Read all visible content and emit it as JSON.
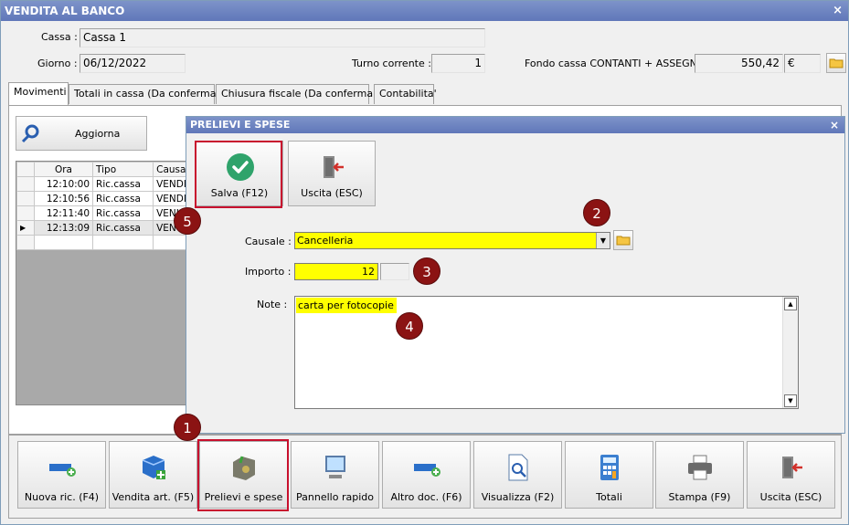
{
  "window": {
    "title": "VENDITA AL BANCO",
    "close": "×"
  },
  "header": {
    "cassa_label": "Cassa :",
    "cassa_value": "Cassa 1",
    "giorno_label": "Giorno :",
    "giorno_value": "06/12/2022",
    "turno_label": "Turno corrente :",
    "turno_value": "1",
    "fondo_label": "Fondo cassa CONTANTI + ASSEGNI :",
    "fondo_value": "550,42",
    "fondo_currency": "€"
  },
  "tabs": [
    "Movimenti",
    "Totali in cassa (Da confermare)",
    "Chiusura fiscale (Da confermare)",
    "Contabilita'"
  ],
  "aggiorna_label": "Aggiorna",
  "grid": {
    "columns": [
      "Ora",
      "Tipo",
      "Causa"
    ],
    "rows": [
      [
        "12:10:00",
        "Ric.cassa",
        "VENDI"
      ],
      [
        "12:10:56",
        "Ric.cassa",
        "VENDI"
      ],
      [
        "12:11:40",
        "Ric.cassa",
        "VENI"
      ],
      [
        "12:13:09",
        "Ric.cassa",
        "VEN"
      ]
    ],
    "current_row_marker": "▶"
  },
  "dialog": {
    "title": "PRELIEVI E SPESE",
    "close": "×",
    "salva_label": "Salva (F12)",
    "uscita_label": "Uscita (ESC)",
    "causale_label": "Causale :",
    "causale_value": "Cancelleria",
    "importo_label": "Importo :",
    "importo_value": "12",
    "note_label": "Note :",
    "note_value": "carta per fotocopie"
  },
  "badges": [
    "1",
    "2",
    "3",
    "4",
    "5"
  ],
  "bottom_buttons": [
    "Nuova ric. (F4)",
    "Vendita art. (F5)",
    "Prelievi e spese",
    "Pannello rapido",
    "Altro doc. (F6)",
    "Visualizza (F2)",
    "Totali",
    "Stampa (F9)",
    "Uscita (ESC)"
  ],
  "colors": {
    "title_bar": "#6d84c2",
    "highlight": "#ffff00",
    "badge": "#8b1313",
    "red_box": "#c8102e",
    "check_green": "#2fa36b"
  }
}
